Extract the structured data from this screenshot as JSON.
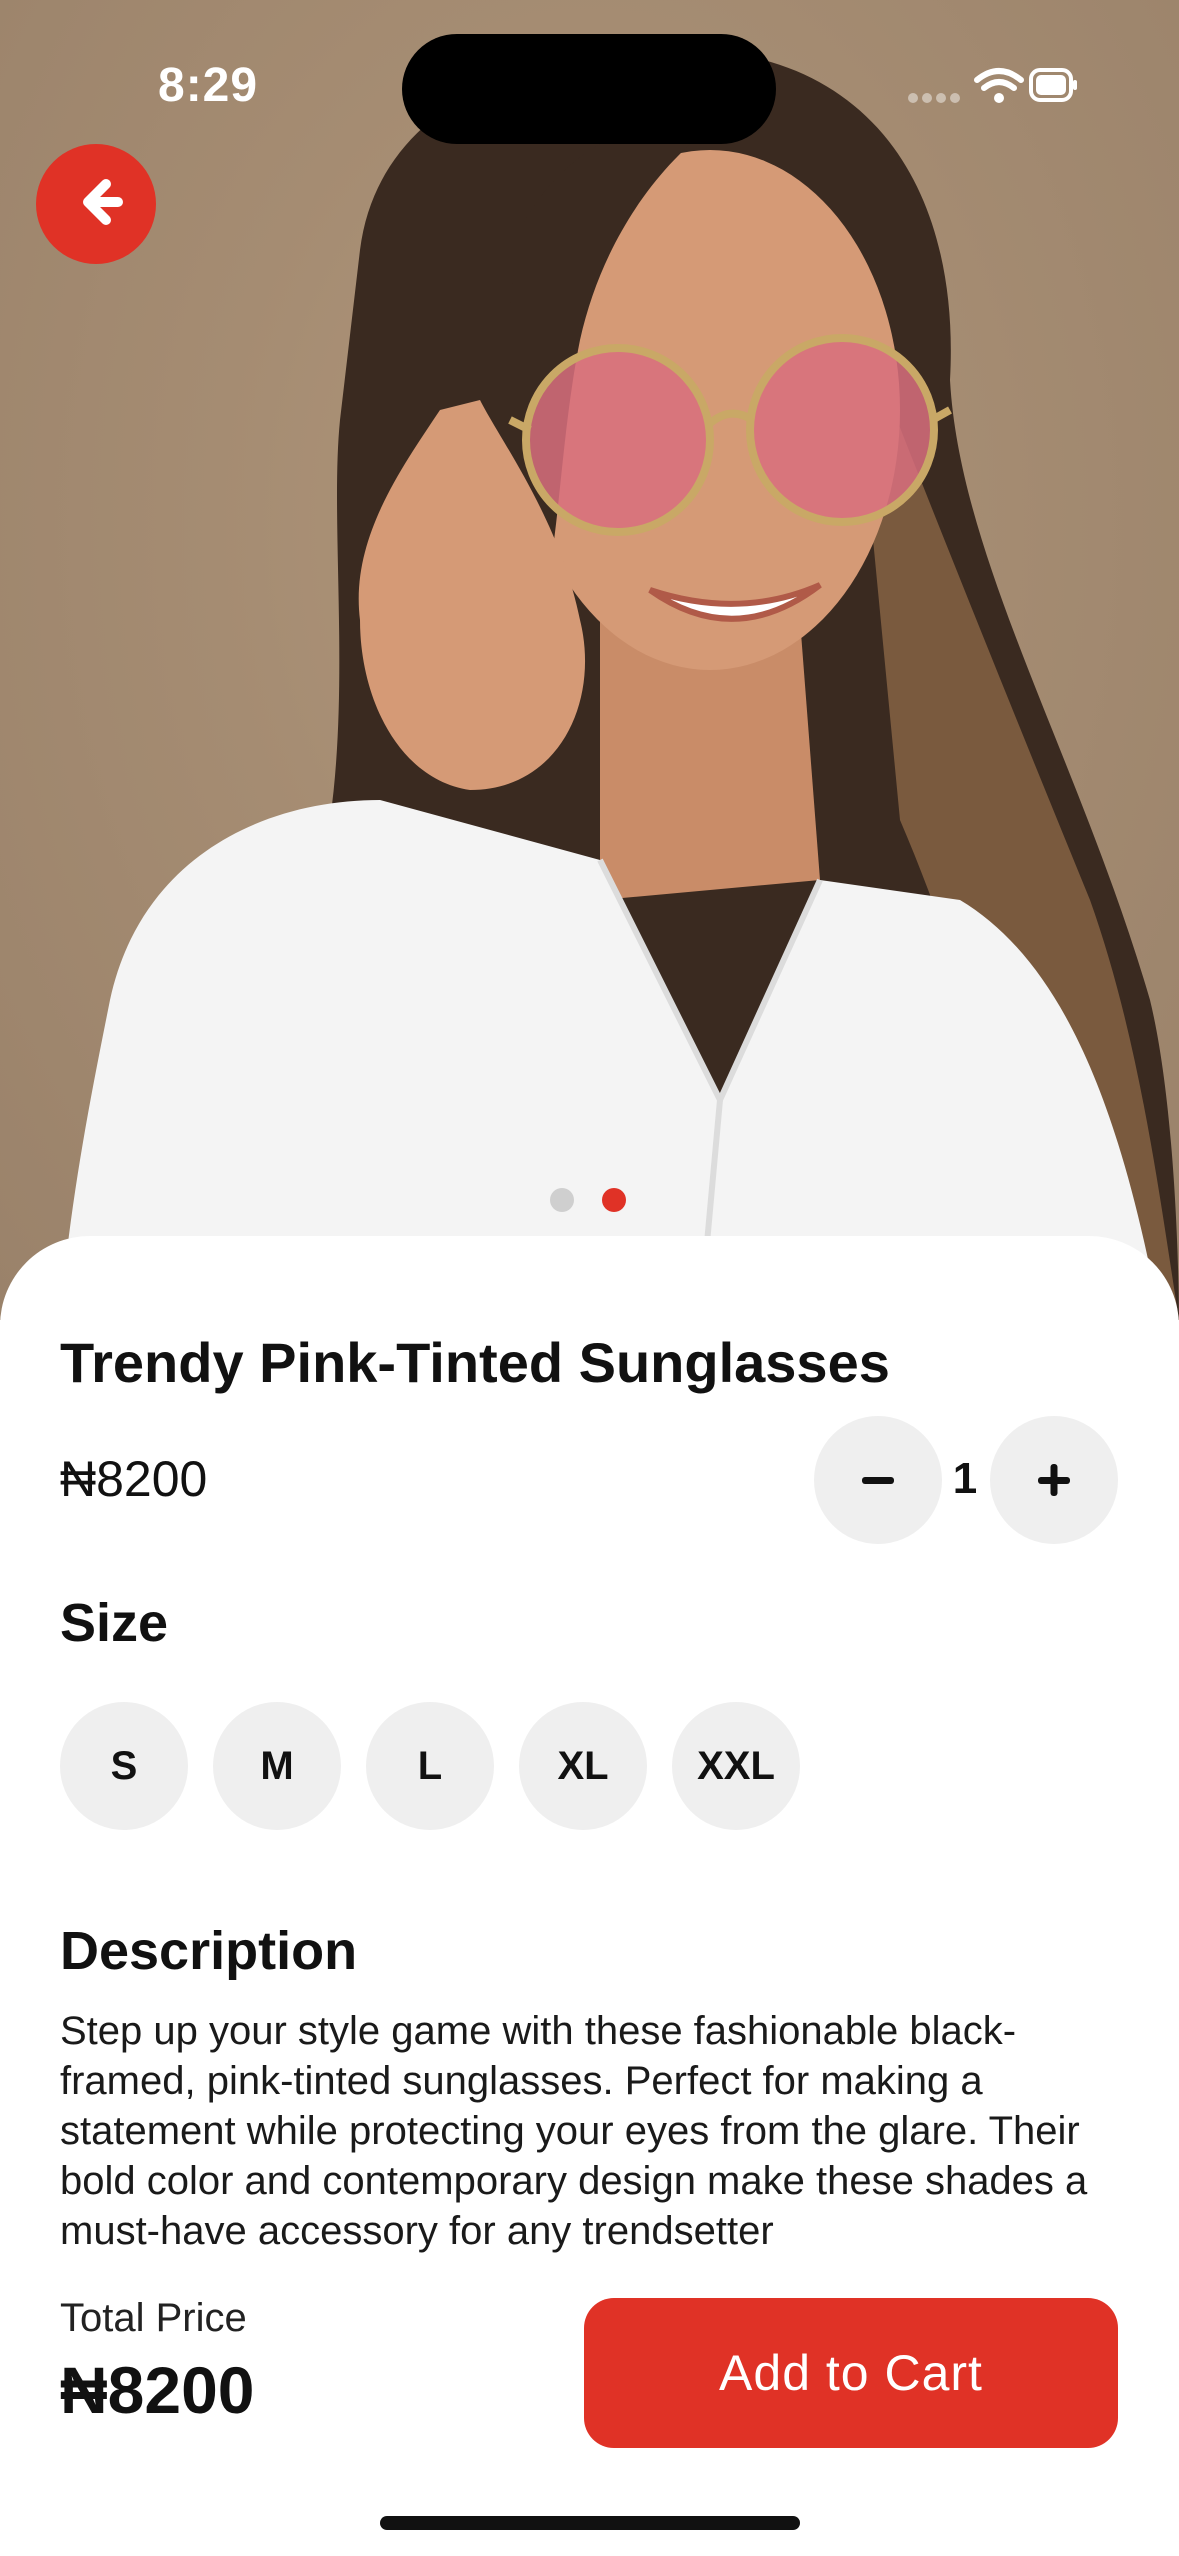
{
  "status_bar": {
    "time": "8:29"
  },
  "product": {
    "title": "Trendy Pink-Tinted Sunglasses",
    "price": "₦8200",
    "quantity": "1",
    "image_count": 2,
    "active_image_index": 1
  },
  "quantity_controls": {
    "decrement_label": "−",
    "increment_label": "+"
  },
  "size": {
    "heading": "Size",
    "options": [
      "S",
      "M",
      "L",
      "XL",
      "XXL"
    ]
  },
  "description": {
    "heading": "Description",
    "text": "Step up your style game with these fashionable black-framed, pink-tinted sunglasses. Perfect for making a statement while protecting your eyes from the glare. Their bold color and contemporary design make these shades a must-have accessory for any trendsetter"
  },
  "footer": {
    "total_label": "Total Price",
    "total_value": "₦8200",
    "add_to_cart_label": "Add to Cart"
  },
  "colors": {
    "accent": "#e03226",
    "chip_bg": "#efefef",
    "backdrop": "#a58c72"
  },
  "icons": [
    "back-arrow-icon",
    "minus-icon",
    "plus-icon",
    "wifi-icon",
    "battery-icon",
    "signal-icon"
  ]
}
